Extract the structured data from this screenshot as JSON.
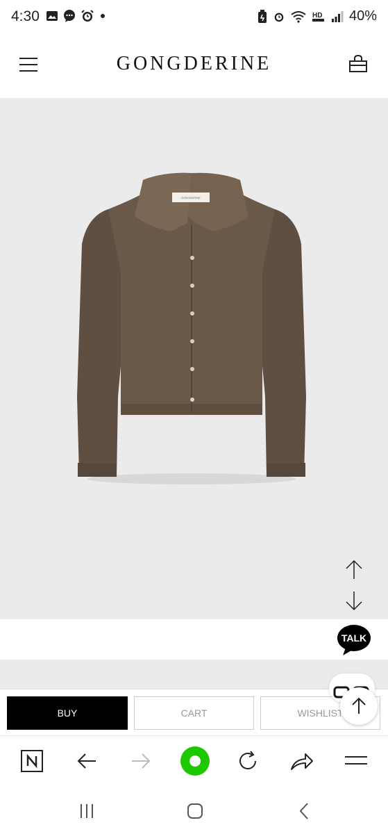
{
  "status_bar": {
    "time": "4:30",
    "battery": "40%",
    "left_icons": [
      "image-icon",
      "chat-icon",
      "alarm-icon",
      "dot-icon"
    ],
    "right_icons": [
      "battery-saver-icon",
      "alarm-icon",
      "wifi-icon",
      "hd-voice-icon",
      "signal-icon"
    ]
  },
  "header": {
    "brand": "GONGDERINE",
    "menu_icon": "hamburger-menu-icon",
    "cart_icon": "shopping-bag-icon"
  },
  "product": {
    "image": "brown-knit-collared-cardigan",
    "label_text": "GONGDERINE"
  },
  "scroll_controls": {
    "up_icon": "arrow-up-icon",
    "down_icon": "arrow-down-icon"
  },
  "talk_button": {
    "label": "TALK"
  },
  "actions": {
    "buy_label": "BUY",
    "cart_label": "CART",
    "wishlist_label": "WISHLIST"
  },
  "browser_toolbar": {
    "items": [
      "naver-icon",
      "back-arrow-icon",
      "forward-arrow-icon",
      "green-home-icon",
      "refresh-icon",
      "share-icon",
      "more-menu-icon"
    ]
  },
  "system_nav": {
    "items": [
      "recent-apps-icon",
      "home-icon",
      "back-icon"
    ]
  },
  "colors": {
    "product_bg": "#ebebeb",
    "buy_bg": "#000000",
    "green_accent": "#1ec800",
    "cardigan": "#6a5949"
  }
}
